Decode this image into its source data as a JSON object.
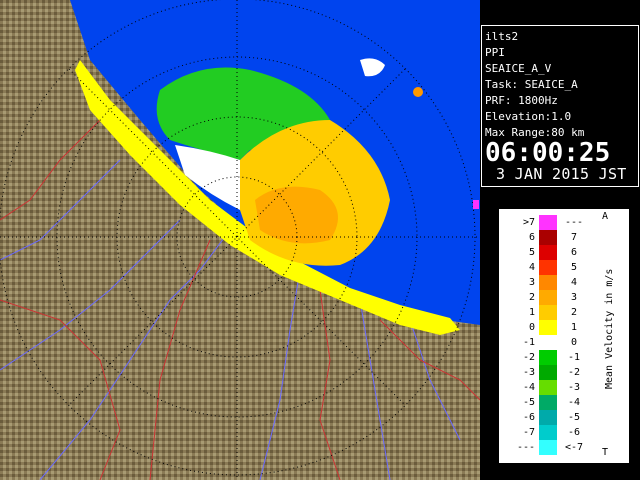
{
  "info": {
    "lines": [
      "ilts2",
      "PPI",
      "SEAICE_A_V",
      "Task: SEAICE_A",
      "PRF: 1800Hz",
      "Elevation:1.0",
      "Max Range:80 km"
    ],
    "time": "06:00:25",
    "date": "3 JAN 2015 JST"
  },
  "legend": {
    "title": "Mean Velocity in m/s",
    "corner_top": "A",
    "corner_bottom": "T",
    "rows": [
      {
        "left": ">7",
        "right": "---",
        "color": "#ff33ff"
      },
      {
        "left": "6",
        "right": "7",
        "color": "#aa0000"
      },
      {
        "left": "5",
        "right": "6",
        "color": "#dd0000"
      },
      {
        "left": "4",
        "right": "5",
        "color": "#ff3300"
      },
      {
        "left": "3",
        "right": "4",
        "color": "#ff8800"
      },
      {
        "left": "2",
        "right": "3",
        "color": "#ffaa00"
      },
      {
        "left": "1",
        "right": "2",
        "color": "#ffcc00"
      },
      {
        "left": "0",
        "right": "1",
        "color": "#ffff00"
      },
      {
        "left": "-1",
        "right": "0",
        "color": "#ffffff"
      },
      {
        "left": "-2",
        "right": "-1",
        "color": "#00cc00"
      },
      {
        "left": "-3",
        "right": "-2",
        "color": "#00aa00"
      },
      {
        "left": "-4",
        "right": "-3",
        "color": "#66dd00"
      },
      {
        "left": "-5",
        "right": "-4",
        "color": "#00aa66"
      },
      {
        "left": "-6",
        "right": "-5",
        "color": "#00aaaa"
      },
      {
        "left": "-7",
        "right": "-6",
        "color": "#00cccc"
      },
      {
        "left": "---",
        "right": "<-7",
        "color": "#33ffff"
      }
    ]
  },
  "colors": {
    "sea": "#0044ee",
    "range_disc": "#2288ff",
    "land": "#8a7a55"
  }
}
